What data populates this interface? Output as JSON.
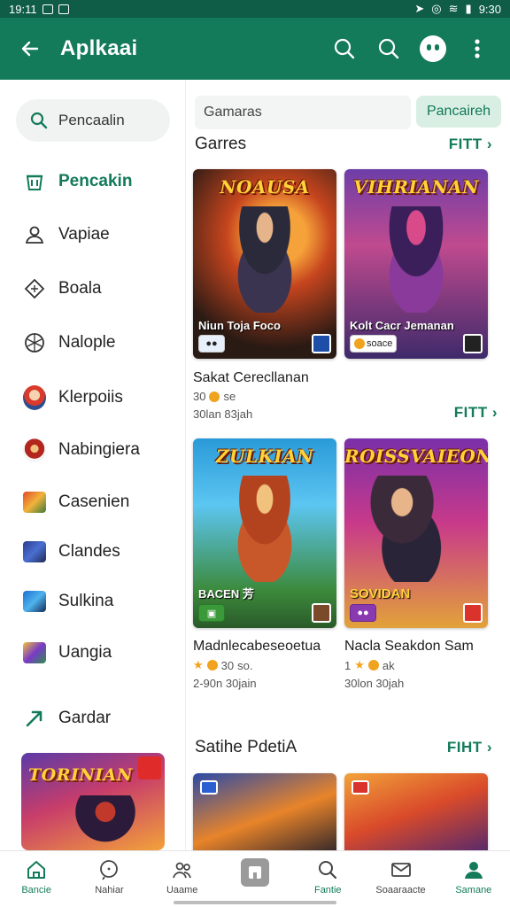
{
  "status_bar": {
    "time": "19:11",
    "right_text": "9:30"
  },
  "app_bar": {
    "title": "Aplkaai"
  },
  "sidebar": {
    "search_label": "Pencaalin",
    "items": [
      {
        "label": "Pencakin",
        "icon": "bag-icon",
        "active": true
      },
      {
        "label": "Vapiae",
        "icon": "person-icon"
      },
      {
        "label": "Boala",
        "icon": "diamond-icon"
      },
      {
        "label": "Nalople",
        "icon": "globe-icon"
      },
      {
        "label": "Klerpoiis",
        "icon": "game-avatar-icon"
      },
      {
        "label": "Nabingiera",
        "icon": "game-avatar-icon"
      },
      {
        "label": "Casenien",
        "icon": "game-thumb-icon"
      },
      {
        "label": "Clandes",
        "icon": "game-thumb-icon"
      },
      {
        "label": "Sulkina",
        "icon": "game-thumb-icon"
      },
      {
        "label": "Uangia",
        "icon": "game-thumb-icon"
      },
      {
        "label": "Gardar",
        "icon": "trend-arrow-icon"
      }
    ],
    "banner_title": "TORINIAN"
  },
  "main": {
    "search": {
      "value": "Gamaras",
      "button": "Pancaireh"
    },
    "section1": {
      "title": "Garres",
      "link": "FITT ›"
    },
    "row1": [
      {
        "art_title": "NOAUSA",
        "caption": "Niun Toja Foco",
        "title": "Sakat Cerecllanan",
        "rating": "30",
        "rating_extra": "se",
        "meta": "30lan 83jah"
      },
      {
        "art_title": "VIHRIANAN",
        "caption": "Kolt Cacr Jemanan",
        "badge": "soace",
        "title": "",
        "rating": "",
        "rating_extra": "",
        "meta": ""
      }
    ],
    "row1_link": "FITT ›",
    "row2": [
      {
        "art_title": "ZULKIAN",
        "caption": "BACEN 芳",
        "title": "Madnlecabeseoetua",
        "rating": "30",
        "rating_extra": "so.",
        "meta": "2-90n 30jain"
      },
      {
        "art_title": "ROISSVAIEON",
        "caption": "SOVIDAN",
        "title": "Nacla Seakdon Sam",
        "rating": "1",
        "rating_extra": "ak",
        "meta": "30lon 30jah"
      }
    ],
    "section2": {
      "title": "Satihe PdetiA",
      "link": "FIHT ›"
    }
  },
  "bottom_nav": [
    {
      "label": "Bancie",
      "icon": "home-icon",
      "active": true
    },
    {
      "label": "Nahiar",
      "icon": "chat-icon"
    },
    {
      "label": "Uaame",
      "icon": "people-icon"
    },
    {
      "label": "",
      "icon": "store-icon"
    },
    {
      "label": "Fantie",
      "icon": "search-icon"
    },
    {
      "label": "Soaaraacte",
      "icon": "mail-icon"
    },
    {
      "label": "Samane",
      "icon": "profile-icon",
      "active": true
    }
  ],
  "colors": {
    "brand": "#137a5a",
    "brand_dark": "#0f5d46",
    "accent_soft": "#d9efe3",
    "star": "#f4a21a"
  }
}
